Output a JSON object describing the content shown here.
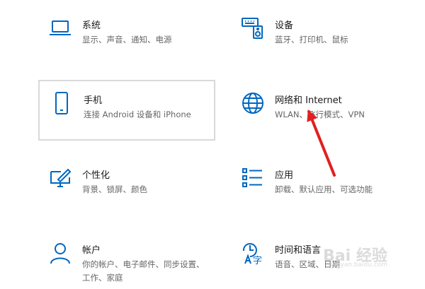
{
  "settings_tiles": [
    {
      "title": "系统",
      "description": "显示、声音、通知、电源",
      "icon": "laptop-icon"
    },
    {
      "title": "设备",
      "description": "蓝牙、打印机、鼠标",
      "icon": "keyboard-speaker-icon"
    },
    {
      "title": "手机",
      "description": "连接 Android 设备和 iPhone",
      "icon": "phone-icon"
    },
    {
      "title": "网络和 Internet",
      "description": "WLAN、飞行模式、VPN",
      "icon": "globe-icon"
    },
    {
      "title": "个性化",
      "description": "背景、锁屏、颜色",
      "icon": "paint-monitor-icon"
    },
    {
      "title": "应用",
      "description": "卸载、默认应用、可选功能",
      "icon": "app-list-icon"
    },
    {
      "title": "帐户",
      "description": "你的帐户、电子邮件、同步设置、工作、家庭",
      "icon": "person-icon"
    },
    {
      "title": "时间和语言",
      "description": "语音、区域、日期",
      "icon": "time-language-icon"
    }
  ],
  "annotation": {
    "arrow_color": "#e02020",
    "points_to": "网络和 Internet"
  },
  "watermark": {
    "text": "Bai 经验",
    "url": "jingyan.baidu.com"
  },
  "accent_color": "#0067c0"
}
